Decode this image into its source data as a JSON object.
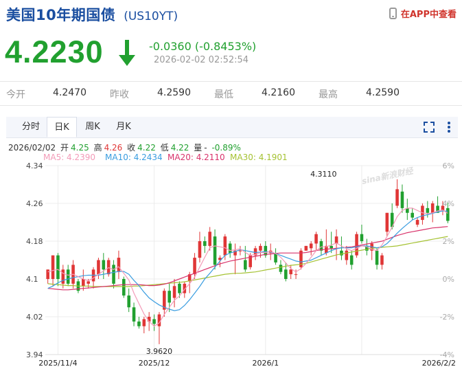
{
  "header": {
    "title": "美国10年期国债",
    "code": "(US10YT)",
    "app_link": "在APP中查看",
    "price": "4.2230",
    "change": "-0.0360 (-0.8453%)",
    "timestamp": "2026-02-02 02:52:54"
  },
  "stats": [
    {
      "label": "今开",
      "value": "4.2470"
    },
    {
      "label": "昨收",
      "value": "4.2590"
    },
    {
      "label": "最低",
      "value": "4.2160"
    },
    {
      "label": "最高",
      "value": "4.2590"
    }
  ],
  "tabs": [
    {
      "label": "分时",
      "active": false
    },
    {
      "label": "日K",
      "active": true
    },
    {
      "label": "周K",
      "active": false
    },
    {
      "label": "月K",
      "active": false
    }
  ],
  "ohlc_bar": {
    "date": "2026/02/02",
    "open_label": "开",
    "open": "4.25",
    "high_label": "高",
    "high": "4.26",
    "close_label": "收",
    "close": "4.22",
    "low_label": "低",
    "low": "4.22",
    "volume_label": "量",
    "volume": "-",
    "pct": "-0.89%"
  },
  "ma_bar": [
    {
      "text": "MA5: 4.2390",
      "color": "#f39bb8"
    },
    {
      "text": "MA10: 4.2434",
      "color": "#3a9de0"
    },
    {
      "text": "MA20: 4.2110",
      "color": "#d9336b"
    },
    {
      "text": "MA30: 4.1901",
      "color": "#a5c232"
    }
  ],
  "colors": {
    "up": "#e03636",
    "down": "#21a02f",
    "title": "#1a4ea0",
    "ma5": "#f39bb8",
    "ma10": "#3a9de0",
    "ma20": "#d9336b",
    "ma30": "#a5c232",
    "grid": "#ececec"
  },
  "watermark": "sina新浪财经",
  "chart_data": {
    "type": "candlestick",
    "y_ticks": [
      "4.34",
      "4.26",
      "4.18",
      "4.1",
      "4.02",
      "3.94"
    ],
    "y_tick_values": [
      4.34,
      4.26,
      4.18,
      4.1,
      4.02,
      3.94
    ],
    "ylim": [
      3.94,
      4.34
    ],
    "pct_ticks": [
      "6%",
      "4%",
      "2%",
      "0%",
      "-2%",
      "-4%"
    ],
    "pct_tick_values": [
      6,
      4,
      2,
      0,
      -2,
      -4
    ],
    "x_labels": [
      {
        "label": "2025/11/4",
        "index": 2
      },
      {
        "label": "2025/12",
        "index": 21
      },
      {
        "label": "2026/1",
        "index": 43
      },
      {
        "label": "2026/2/2",
        "index": 62
      }
    ],
    "annotations": [
      {
        "label": "4.3110",
        "index": 55,
        "value": 4.311,
        "kind": "high"
      },
      {
        "label": "3.9620",
        "index": 22,
        "value": 3.962,
        "kind": "low"
      }
    ],
    "candles": [
      {
        "o": 4.1,
        "h": 4.12,
        "l": 4.09,
        "c": 4.12
      },
      {
        "o": 4.1,
        "h": 4.15,
        "l": 4.085,
        "c": 4.15
      },
      {
        "o": 4.15,
        "h": 4.155,
        "l": 4.085,
        "c": 4.1
      },
      {
        "o": 4.09,
        "h": 4.13,
        "l": 4.08,
        "c": 4.12
      },
      {
        "o": 4.12,
        "h": 4.13,
        "l": 4.085,
        "c": 4.09
      },
      {
        "o": 4.09,
        "h": 4.14,
        "l": 4.08,
        "c": 4.13
      },
      {
        "o": 4.095,
        "h": 4.1,
        "l": 4.07,
        "c": 4.075
      },
      {
        "o": 4.085,
        "h": 4.12,
        "l": 4.075,
        "c": 4.1
      },
      {
        "o": 4.09,
        "h": 4.1,
        "l": 4.08,
        "c": 4.095
      },
      {
        "o": 4.095,
        "h": 4.125,
        "l": 4.08,
        "c": 4.12
      },
      {
        "o": 4.11,
        "h": 4.145,
        "l": 4.1,
        "c": 4.14
      },
      {
        "o": 4.14,
        "h": 4.155,
        "l": 4.1,
        "c": 4.12
      },
      {
        "o": 4.11,
        "h": 4.145,
        "l": 4.105,
        "c": 4.14
      },
      {
        "o": 4.13,
        "h": 4.14,
        "l": 4.08,
        "c": 4.09
      },
      {
        "o": 4.115,
        "h": 4.16,
        "l": 4.1,
        "c": 4.145
      },
      {
        "o": 4.1,
        "h": 4.105,
        "l": 4.06,
        "c": 4.065
      },
      {
        "o": 4.065,
        "h": 4.08,
        "l": 4.03,
        "c": 4.04
      },
      {
        "o": 4.04,
        "h": 4.05,
        "l": 4.0,
        "c": 4.01
      },
      {
        "o": 4.01,
        "h": 4.02,
        "l": 3.995,
        "c": 4.0
      },
      {
        "o": 4.0,
        "h": 4.02,
        "l": 3.985,
        "c": 4.015
      },
      {
        "o": 4.01,
        "h": 4.03,
        "l": 3.99,
        "c": 4.02
      },
      {
        "o": 4.015,
        "h": 4.025,
        "l": 3.99,
        "c": 4.005
      },
      {
        "o": 4.0,
        "h": 4.03,
        "l": 3.962,
        "c": 4.025
      },
      {
        "o": 4.035,
        "h": 4.08,
        "l": 4.02,
        "c": 4.075
      },
      {
        "o": 4.075,
        "h": 4.09,
        "l": 4.03,
        "c": 4.05
      },
      {
        "o": 4.06,
        "h": 4.1,
        "l": 4.04,
        "c": 4.085
      },
      {
        "o": 4.09,
        "h": 4.095,
        "l": 4.06,
        "c": 4.07
      },
      {
        "o": 4.07,
        "h": 4.095,
        "l": 4.06,
        "c": 4.09
      },
      {
        "o": 4.095,
        "h": 4.115,
        "l": 4.07,
        "c": 4.11
      },
      {
        "o": 4.11,
        "h": 4.155,
        "l": 4.1,
        "c": 4.145
      },
      {
        "o": 4.145,
        "h": 4.2,
        "l": 4.135,
        "c": 4.18
      },
      {
        "o": 4.18,
        "h": 4.19,
        "l": 4.155,
        "c": 4.17
      },
      {
        "o": 4.17,
        "h": 4.21,
        "l": 4.16,
        "c": 4.2
      },
      {
        "o": 4.19,
        "h": 4.205,
        "l": 4.12,
        "c": 4.13
      },
      {
        "o": 4.14,
        "h": 4.15,
        "l": 4.125,
        "c": 4.145
      },
      {
        "o": 4.15,
        "h": 4.195,
        "l": 4.14,
        "c": 4.19
      },
      {
        "o": 4.175,
        "h": 4.18,
        "l": 4.145,
        "c": 4.155
      },
      {
        "o": 4.15,
        "h": 4.175,
        "l": 4.11,
        "c": 4.16
      },
      {
        "o": 4.16,
        "h": 4.17,
        "l": 4.15,
        "c": 4.16
      },
      {
        "o": 4.14,
        "h": 4.17,
        "l": 4.115,
        "c": 4.12
      },
      {
        "o": 4.125,
        "h": 4.155,
        "l": 4.12,
        "c": 4.15
      },
      {
        "o": 4.15,
        "h": 4.17,
        "l": 4.14,
        "c": 4.165
      },
      {
        "o": 4.16,
        "h": 4.175,
        "l": 4.145,
        "c": 4.17
      },
      {
        "o": 4.17,
        "h": 4.18,
        "l": 4.145,
        "c": 4.15
      },
      {
        "o": 4.155,
        "h": 4.175,
        "l": 4.14,
        "c": 4.16
      },
      {
        "o": 4.155,
        "h": 4.165,
        "l": 4.13,
        "c": 4.135
      },
      {
        "o": 4.13,
        "h": 4.14,
        "l": 4.11,
        "c": 4.115
      },
      {
        "o": 4.12,
        "h": 4.135,
        "l": 4.095,
        "c": 4.1
      },
      {
        "o": 4.11,
        "h": 4.13,
        "l": 4.1,
        "c": 4.12
      },
      {
        "o": 4.11,
        "h": 4.12,
        "l": 4.1,
        "c": 4.11
      },
      {
        "o": 4.125,
        "h": 4.165,
        "l": 4.12,
        "c": 4.16
      },
      {
        "o": 4.16,
        "h": 4.17,
        "l": 4.16,
        "c": 4.17
      },
      {
        "o": 4.165,
        "h": 4.18,
        "l": 4.15,
        "c": 4.175
      },
      {
        "o": 4.175,
        "h": 4.2,
        "l": 4.16,
        "c": 4.195
      },
      {
        "o": 4.18,
        "h": 4.185,
        "l": 4.15,
        "c": 4.16
      },
      {
        "o": 4.155,
        "h": 4.205,
        "l": 4.15,
        "c": 4.17
      },
      {
        "o": 4.17,
        "h": 4.2,
        "l": 4.155,
        "c": 4.165
      },
      {
        "o": 4.175,
        "h": 4.205,
        "l": 4.14,
        "c": 4.19
      },
      {
        "o": 4.16,
        "h": 4.19,
        "l": 4.14,
        "c": 4.15
      },
      {
        "o": 4.14,
        "h": 4.17,
        "l": 4.13,
        "c": 4.16
      },
      {
        "o": 4.15,
        "h": 4.16,
        "l": 4.12,
        "c": 4.13
      },
      {
        "o": 4.15,
        "h": 4.2,
        "l": 4.145,
        "c": 4.195
      },
      {
        "o": 4.195,
        "h": 4.215,
        "l": 4.175,
        "c": 4.18
      },
      {
        "o": 4.17,
        "h": 4.185,
        "l": 4.15,
        "c": 4.16
      },
      {
        "o": 4.16,
        "h": 4.18,
        "l": 4.14,
        "c": 4.175
      },
      {
        "o": 4.16,
        "h": 4.165,
        "l": 4.12,
        "c": 4.13
      },
      {
        "o": 4.13,
        "h": 4.155,
        "l": 4.12,
        "c": 4.15
      },
      {
        "o": 4.2,
        "h": 4.24,
        "l": 4.19,
        "c": 4.24
      },
      {
        "o": 4.24,
        "h": 4.26,
        "l": 4.205,
        "c": 4.21
      },
      {
        "o": 4.255,
        "h": 4.311,
        "l": 4.25,
        "c": 4.29
      },
      {
        "o": 4.285,
        "h": 4.3,
        "l": 4.24,
        "c": 4.25
      },
      {
        "o": 4.25,
        "h": 4.27,
        "l": 4.225,
        "c": 4.24
      },
      {
        "o": 4.24,
        "h": 4.25,
        "l": 4.225,
        "c": 4.23
      },
      {
        "o": 4.215,
        "h": 4.23,
        "l": 4.21,
        "c": 4.225
      },
      {
        "o": 4.225,
        "h": 4.26,
        "l": 4.215,
        "c": 4.255
      },
      {
        "o": 4.25,
        "h": 4.265,
        "l": 4.23,
        "c": 4.24
      },
      {
        "o": 4.24,
        "h": 4.265,
        "l": 4.22,
        "c": 4.26
      },
      {
        "o": 4.255,
        "h": 4.275,
        "l": 4.24,
        "c": 4.24
      },
      {
        "o": 4.245,
        "h": 4.265,
        "l": 4.235,
        "c": 4.255
      },
      {
        "o": 4.25,
        "h": 4.262,
        "l": 4.218,
        "c": 4.223
      }
    ],
    "ma5": [
      4.115,
      4.118,
      4.12,
      4.112,
      4.108,
      4.11,
      4.105,
      4.1,
      4.096,
      4.102,
      4.11,
      4.117,
      4.124,
      4.12,
      4.126,
      4.112,
      4.098,
      4.07,
      4.048,
      4.026,
      4.01,
      4.0,
      4.007,
      4.025,
      4.04,
      4.055,
      4.064,
      4.078,
      4.09,
      4.104,
      4.125,
      4.146,
      4.166,
      4.17,
      4.168,
      4.166,
      4.16,
      4.162,
      4.164,
      4.156,
      4.15,
      4.152,
      4.156,
      4.156,
      4.158,
      4.154,
      4.146,
      4.134,
      4.122,
      4.115,
      4.122,
      4.133,
      4.146,
      4.16,
      4.168,
      4.168,
      4.172,
      4.176,
      4.17,
      4.164,
      4.16,
      4.165,
      4.17,
      4.168,
      4.163,
      4.16,
      4.172,
      4.19,
      4.21,
      4.232,
      4.245,
      4.25,
      4.25,
      4.245,
      4.24,
      4.238,
      4.24,
      4.244,
      4.246,
      4.239
    ],
    "ma10": [
      4.08,
      4.085,
      4.092,
      4.097,
      4.1,
      4.103,
      4.105,
      4.107,
      4.108,
      4.108,
      4.108,
      4.11,
      4.112,
      4.114,
      4.116,
      4.116,
      4.11,
      4.097,
      4.086,
      4.072,
      4.06,
      4.052,
      4.045,
      4.04,
      4.036,
      4.033,
      4.035,
      4.044,
      4.056,
      4.07,
      4.084,
      4.1,
      4.112,
      4.125,
      4.138,
      4.15,
      4.155,
      4.158,
      4.162,
      4.16,
      4.158,
      4.156,
      4.157,
      4.158,
      4.157,
      4.154,
      4.15,
      4.146,
      4.142,
      4.138,
      4.136,
      4.138,
      4.14,
      4.145,
      4.15,
      4.155,
      4.16,
      4.164,
      4.166,
      4.166,
      4.166,
      4.168,
      4.17,
      4.17,
      4.168,
      4.166,
      4.168,
      4.175,
      4.186,
      4.197,
      4.207,
      4.216,
      4.225,
      4.23,
      4.234,
      4.236,
      4.239,
      4.242,
      4.244,
      4.2434
    ],
    "ma20": [
      4.08,
      4.079,
      4.078,
      4.077,
      4.077,
      4.078,
      4.079,
      4.08,
      4.081,
      4.082,
      4.083,
      4.084,
      4.085,
      4.086,
      4.087,
      4.088,
      4.088,
      4.088,
      4.088,
      4.087,
      4.086,
      4.086,
      4.087,
      4.089,
      4.092,
      4.096,
      4.1,
      4.104,
      4.108,
      4.112,
      4.116,
      4.12,
      4.124,
      4.128,
      4.132,
      4.135,
      4.138,
      4.14,
      4.142,
      4.144,
      4.146,
      4.148,
      4.15,
      4.152,
      4.153,
      4.154,
      4.155,
      4.155,
      4.155,
      4.155,
      4.155,
      4.156,
      4.158,
      4.16,
      4.162,
      4.163,
      4.164,
      4.165,
      4.166,
      4.167,
      4.168,
      4.17,
      4.172,
      4.174,
      4.176,
      4.178,
      4.18,
      4.184,
      4.188,
      4.192,
      4.195,
      4.198,
      4.2,
      4.202,
      4.204,
      4.206,
      4.208,
      4.209,
      4.21,
      4.211
    ],
    "ma30": [
      4.09,
      4.089,
      4.088,
      4.087,
      4.086,
      4.086,
      4.085,
      4.085,
      4.085,
      4.084,
      4.084,
      4.084,
      4.084,
      4.084,
      4.084,
      4.084,
      4.084,
      4.085,
      4.085,
      4.086,
      4.087,
      4.088,
      4.089,
      4.09,
      4.091,
      4.092,
      4.093,
      4.094,
      4.096,
      4.098,
      4.1,
      4.102,
      4.104,
      4.106,
      4.108,
      4.11,
      4.111,
      4.112,
      4.112,
      4.113,
      4.114,
      4.115,
      4.117,
      4.119,
      4.121,
      4.123,
      4.125,
      4.127,
      4.129,
      4.13,
      4.131,
      4.133,
      4.136,
      4.139,
      4.142,
      4.145,
      4.148,
      4.151,
      4.153,
      4.155,
      4.157,
      4.159,
      4.161,
      4.163,
      4.165,
      4.166,
      4.167,
      4.168,
      4.169,
      4.17,
      4.172,
      4.174,
      4.176,
      4.178,
      4.18,
      4.182,
      4.184,
      4.186,
      4.188,
      4.19
    ]
  }
}
